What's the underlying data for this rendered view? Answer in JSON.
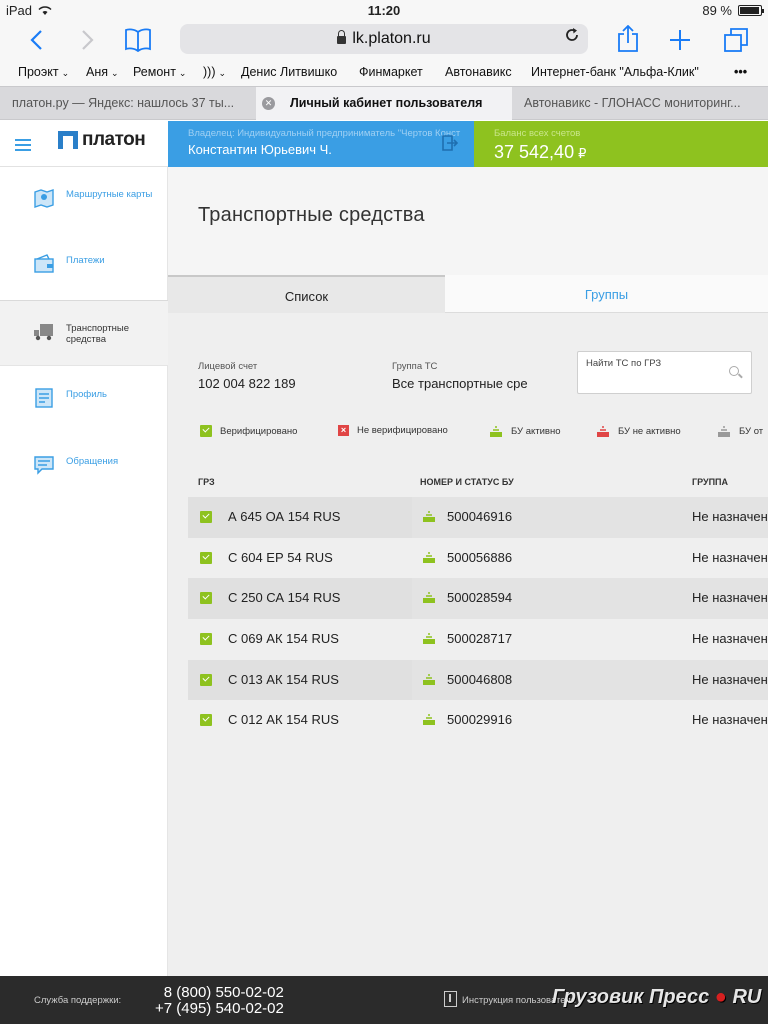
{
  "status_bar": {
    "device": "iPad",
    "time": "11:20",
    "battery": "89 %"
  },
  "browser": {
    "url": "lk.platon.ru",
    "bookmarks": [
      {
        "label": "Проэкт",
        "folder": true
      },
      {
        "label": "Аня",
        "folder": true
      },
      {
        "label": "Ремонт",
        "folder": true
      },
      {
        "label": ")))",
        "folder": true
      },
      {
        "label": "Денис Литвишко",
        "folder": false
      },
      {
        "label": "Финмаркет",
        "folder": false
      },
      {
        "label": "Автонавикс",
        "folder": false
      },
      {
        "label": "Интернет-банк \"Альфа-Клик\"",
        "folder": false
      }
    ],
    "more": "•••",
    "tabs": [
      {
        "label": "платон.ру — Яндекс: нашлось 37 ты..."
      },
      {
        "label": "Личный кабинет пользователя"
      },
      {
        "label": "Автонавикс - ГЛОНАСС мониторинг..."
      }
    ]
  },
  "header": {
    "logo": "платон",
    "owner_label": "Владелец: Индивидуальный предприниматель \"Чертов Конст",
    "owner_name": "Константин Юрьевич Ч.",
    "balance_label": "Баланс всех счетов",
    "balance_amount": "37 542,40",
    "currency": "₽"
  },
  "sidebar": {
    "items": [
      {
        "label": "Маршрутные карты",
        "icon": "map-icon"
      },
      {
        "label": "Платежи",
        "icon": "wallet-icon"
      },
      {
        "label": "Транспортные средства",
        "icon": "truck-icon"
      },
      {
        "label": "Профиль",
        "icon": "profile-icon"
      },
      {
        "label": "Обращения",
        "icon": "message-icon"
      }
    ]
  },
  "main": {
    "title": "Транспортные средства",
    "tabs": [
      {
        "label": "Список"
      },
      {
        "label": "Группы"
      }
    ],
    "account_label": "Лицевой счет",
    "account_value": "102 004 822 189",
    "group_label": "Группа ТС",
    "group_value": "Все транспортные сре",
    "search_placeholder": "Найти ТС по ГРЗ",
    "legend": [
      {
        "label": "Верифицировано"
      },
      {
        "label": "Не верифицировано"
      },
      {
        "label": "БУ активно"
      },
      {
        "label": "БУ не активно"
      },
      {
        "label": "БУ от"
      }
    ],
    "columns": {
      "plate": "ГРЗ",
      "obu": "НОМЕР И СТАТУС БУ",
      "group": "ГРУППА"
    },
    "rows": [
      {
        "plate": "А 645 ОА 154 RUS",
        "obu": "500046916",
        "group": "Не назначен"
      },
      {
        "plate": "С 604 ЕР 54 RUS",
        "obu": "500056886",
        "group": "Не назначен"
      },
      {
        "plate": "С 250 СА 154 RUS",
        "obu": "500028594",
        "group": "Не назначен"
      },
      {
        "plate": "С 069 АК 154 RUS",
        "obu": "500028717",
        "group": "Не назначен"
      },
      {
        "plate": "С 013 АК 154 RUS",
        "obu": "500046808",
        "group": "Не назначен"
      },
      {
        "plate": "С 012 АК 154 RUS",
        "obu": "500029916",
        "group": "Не назначен"
      }
    ]
  },
  "footer": {
    "support_label": "Служба поддержки:",
    "phone1": "8 (800) 550-02-02",
    "phone2": "+7 (495) 540-02-02",
    "manual": "Инструкция пользователя",
    "watermark": "Грузовик Пресс",
    "watermark_dot": "●",
    "watermark_ru": "RU"
  },
  "colors": {
    "accent_blue": "#3a9ee4",
    "accent_green": "#8ec21f",
    "danger_red": "#e04545",
    "footer_bg": "#2b2b2b"
  }
}
